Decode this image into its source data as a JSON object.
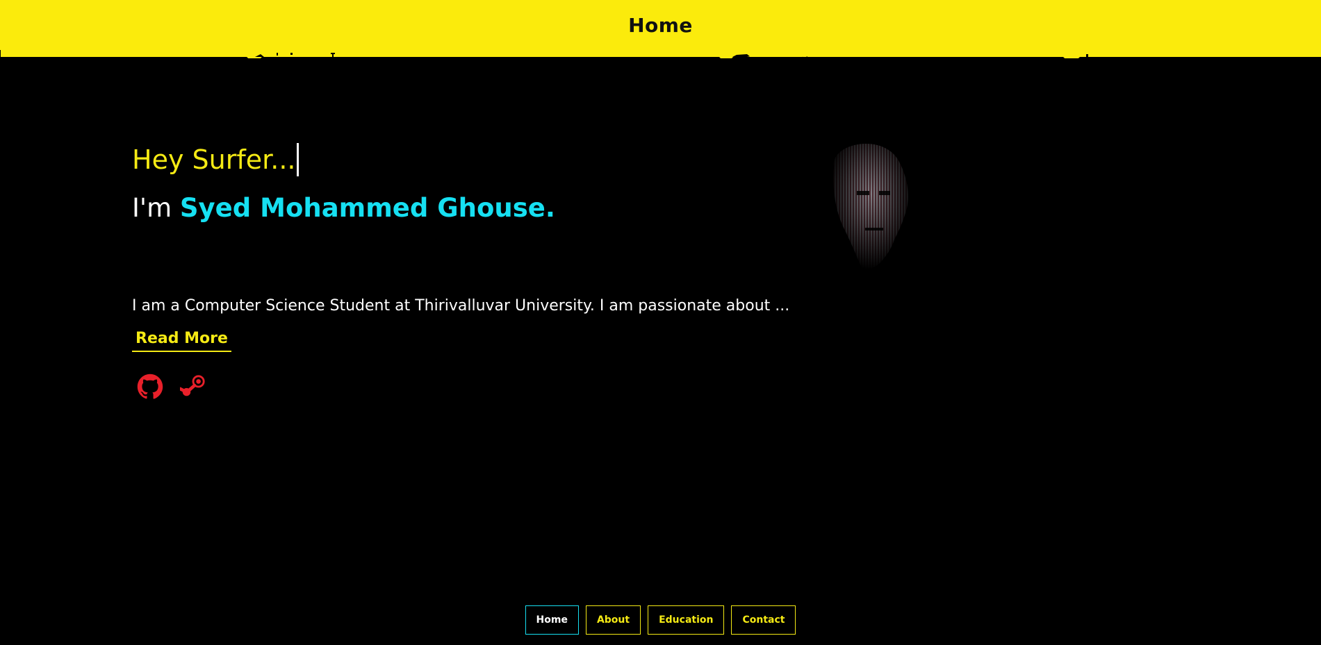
{
  "header": {
    "title": "Home"
  },
  "hero": {
    "greeting": "Hey Surfer...",
    "intro_prefix": "I'm ",
    "name": "Syed Mohammed Ghouse.",
    "bio": "I am a Computer Science Student at Thirivalluvar University. I am passionate about ...",
    "read_more": "Read More"
  },
  "socials": [
    {
      "icon": "github-icon"
    },
    {
      "icon": "steam-icon"
    }
  ],
  "nav": {
    "items": [
      {
        "label": "Home",
        "active": true
      },
      {
        "label": "About",
        "active": false
      },
      {
        "label": "Education",
        "active": false
      },
      {
        "label": "Contact",
        "active": false
      }
    ]
  },
  "colors": {
    "accent_yellow": "#f5ea14",
    "accent_cyan": "#16e0f2",
    "social_red": "#e8202a",
    "background": "#000000"
  }
}
